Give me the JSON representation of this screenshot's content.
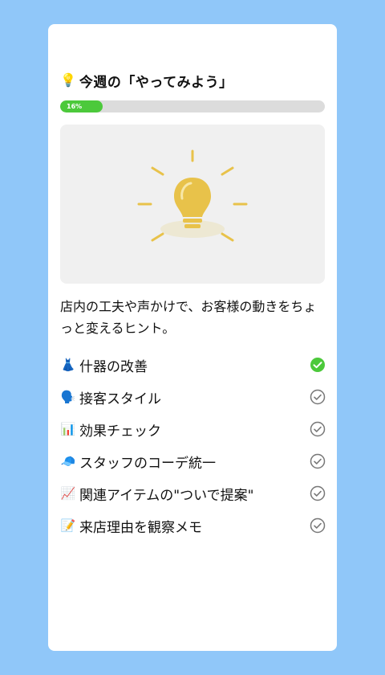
{
  "heading": {
    "icon": "lightbulb-icon",
    "emoji": "💡",
    "title": "今週の「やってみよう」"
  },
  "progress": {
    "value_percent": 16,
    "label": "16%",
    "fill_color": "#4cc93b",
    "track_color": "#dcdcdc"
  },
  "hero": {
    "icon": "lightbulb-illustration",
    "background": "#f0f0f0",
    "accent": "#e8c24a"
  },
  "description": "店内の工夫や声かけで、お客様の動きをちょっと変えるヒント。",
  "tasks": [
    {
      "emoji": "👗",
      "icon": "dress-icon",
      "label": "什器の改善",
      "done": true
    },
    {
      "emoji": "🗣️",
      "icon": "speaking-head-icon",
      "label": "接客スタイル",
      "done": false
    },
    {
      "emoji": "📊",
      "icon": "bar-chart-icon",
      "label": "効果チェック",
      "done": false
    },
    {
      "emoji": "🧢",
      "icon": "cap-icon",
      "label": "スタッフのコーデ統一",
      "done": false
    },
    {
      "emoji": "📈",
      "icon": "chart-increasing-icon",
      "label": "関連アイテムの\"ついで提案\"",
      "done": false
    },
    {
      "emoji": "📝",
      "icon": "memo-icon",
      "label": "来店理由を観察メモ",
      "done": false
    }
  ],
  "colors": {
    "page_background": "#90c7f9",
    "check_done": "#4cc93b",
    "check_todo": "#777777"
  }
}
